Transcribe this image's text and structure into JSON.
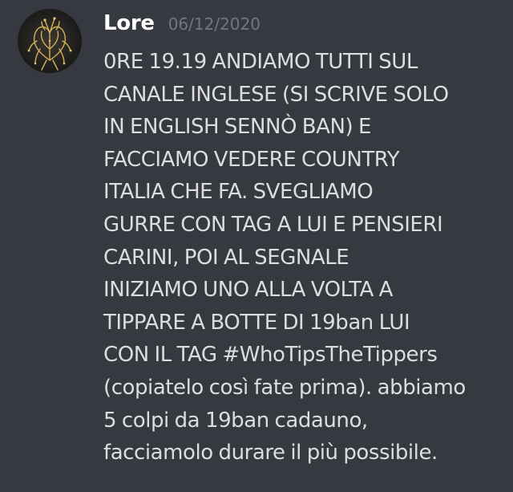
{
  "message": {
    "author": "Lore",
    "timestamp": "06/12/2020",
    "avatar_icon": "golden-heart-illustration-icon",
    "text": "0RE 19.19 ANDIAMO TUTTI SUL\nCANALE INGLESE (SI SCRIVE SOLO\nIN ENGLISH SENNÒ BAN) E\nFACCIAMO VEDERE COUNTRY\nITALIA CHE FA.    SVEGLIAMO\nGURRE CON TAG A LUI E PENSIERI\nCARINI, POI AL SEGNALE\nINIZIAMO UNO ALLA VOLTA A\nTIPPARE A BOTTE DI 19ban LUI\nCON IL TAG #WhoTipsTheTippers\n(copiatelo così fate prima). abbiamo\n5 colpi da 19ban cadauno,\nfacciamolo durare il più possibile."
  },
  "colors": {
    "background": "#36393f",
    "username": "#ffffff",
    "timestamp": "#72767d",
    "message_text": "#dcddde",
    "avatar_gold": "#d4b25a"
  }
}
